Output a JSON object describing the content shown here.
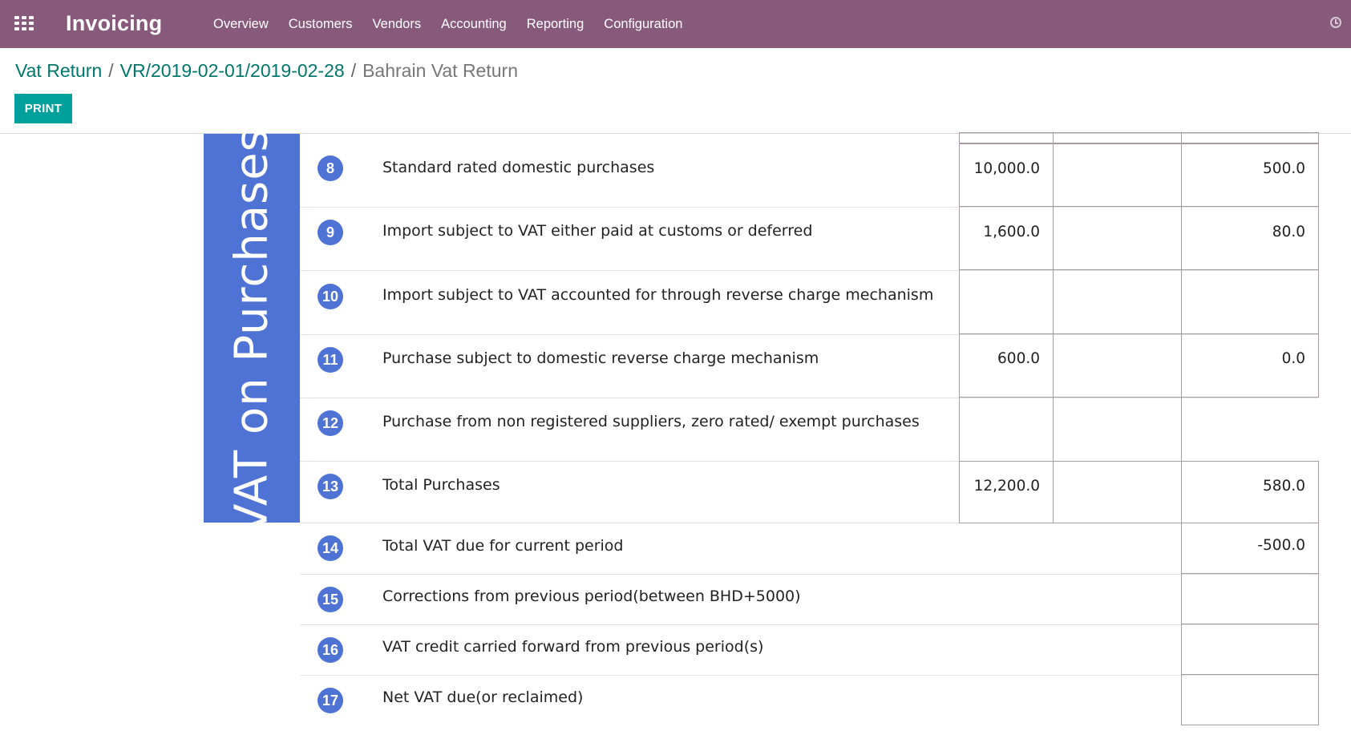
{
  "navbar": {
    "app_name": "Invoicing",
    "apps_icon": "apps-grid-icon",
    "menu": [
      "Overview",
      "Customers",
      "Vendors",
      "Accounting",
      "Reporting",
      "Configuration"
    ],
    "right_icon": "clock-icon",
    "color": "#875a7b"
  },
  "breadcrumb": {
    "items": [
      "Vat Return",
      "VR/2019-02-01/2019-02-28"
    ],
    "separator": "/",
    "current": "Bahrain Vat Return"
  },
  "actions": {
    "print_label": "PRINT",
    "print_color": "#00a09d"
  },
  "report": {
    "section_label": "VAT on Purchases",
    "section_color": "#4e73d4",
    "rows": [
      {
        "num": "8",
        "desc": "Standard rated domestic purchases",
        "amount": "10,000.0",
        "adjust": "",
        "vat": "500.0"
      },
      {
        "num": "9",
        "desc": "Import subject to VAT either paid at customs or deferred",
        "amount": "1,600.0",
        "adjust": "",
        "vat": "80.0"
      },
      {
        "num": "10",
        "desc": "Import subject to VAT accounted for through reverse charge mechanism",
        "amount": "",
        "adjust": "",
        "vat": ""
      },
      {
        "num": "11",
        "desc": "Purchase subject to domestic reverse charge mechanism",
        "amount": "600.0",
        "adjust": "",
        "vat": "0.0"
      },
      {
        "num": "12",
        "desc": "Purchase from non registered suppliers, zero rated/ exempt purchases",
        "amount": "",
        "adjust": "",
        "vat": ""
      },
      {
        "num": "13",
        "desc": "Total Purchases",
        "amount": "12,200.0",
        "adjust": "",
        "vat": "580.0"
      },
      {
        "num": "14",
        "desc": "Total VAT due for current period",
        "vat": "-500.0"
      },
      {
        "num": "15",
        "desc": "Corrections from previous period(between BHD+5000)",
        "vat": ""
      },
      {
        "num": "16",
        "desc": "VAT credit carried forward from previous period(s)",
        "vat": ""
      },
      {
        "num": "17",
        "desc": "Net VAT due(or reclaimed)",
        "vat": ""
      }
    ]
  }
}
